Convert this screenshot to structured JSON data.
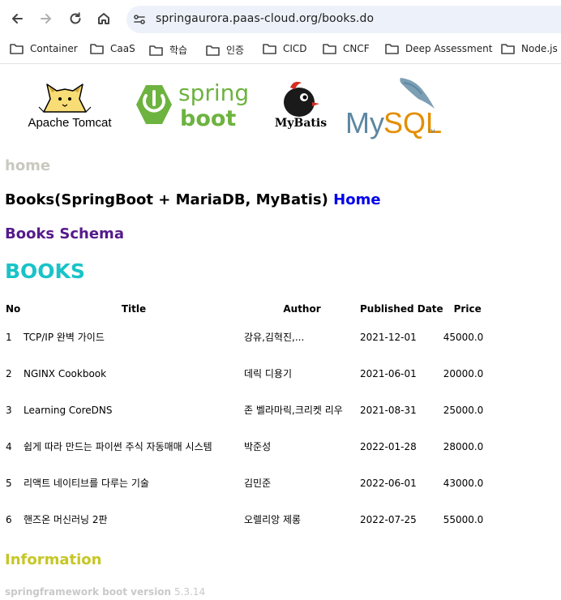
{
  "browser": {
    "url": "springaurora.paas-cloud.org/books.do",
    "bookmarks": [
      "Container",
      "CaaS",
      "학습",
      "인증",
      "CICD",
      "CNCF",
      "Deep Assessment",
      "Node.js"
    ]
  },
  "logos": {
    "tomcat": "Apache Tomcat",
    "spring_1": "spring",
    "spring_2": "boot",
    "mybatis": "MyBatis",
    "mysql_1": "My",
    "mysql_2": "SQL",
    "mysql_tm": "TM"
  },
  "colors": {
    "home_heading": "#c9c9c0",
    "books_heading": "#19c3c8",
    "info_heading": "#c6c626",
    "link": "#0000ee",
    "visited_link": "#551a8b",
    "spring_green": "#6db33f",
    "mysql_blue": "#5d87a1",
    "mysql_orange": "#e48e00"
  },
  "page": {
    "home_heading": "home",
    "title": "Books(SpringBoot + MariaDB, MyBatis)",
    "home_link": "Home",
    "schema_link": "Books Schema",
    "books_heading": "BOOKS",
    "info_heading": "Information",
    "version_label": "springframework boot version",
    "version_value": "5.3.14"
  },
  "table": {
    "headers": {
      "no": "No",
      "title": "Title",
      "author": "Author",
      "date": "Published Date",
      "price": "Price"
    },
    "rows": [
      {
        "no": "1",
        "title": "TCP/IP 완벽 가이드",
        "author": "강유,김혁진,...",
        "date": "2021-12-01",
        "price": "45000.0"
      },
      {
        "no": "2",
        "title": "NGINX Cookbook",
        "author": "데릭 디용기",
        "date": "2021-06-01",
        "price": "20000.0"
      },
      {
        "no": "3",
        "title": "Learning CoreDNS",
        "author": "존 벨라마릭,크리켓 리우",
        "date": "2021-08-31",
        "price": "25000.0"
      },
      {
        "no": "4",
        "title": "쉽게 따라 만드는 파이썬 주식 자동매매 시스템",
        "author": "박준성",
        "date": "2022-01-28",
        "price": "28000.0"
      },
      {
        "no": "5",
        "title": "리액트 네이티브를 다루는 기술",
        "author": "김민준",
        "date": "2022-06-01",
        "price": "43000.0"
      },
      {
        "no": "6",
        "title": "핸즈온 머신러닝 2판",
        "author": "오렐리앙 제롱",
        "date": "2022-07-25",
        "price": "55000.0"
      }
    ]
  }
}
